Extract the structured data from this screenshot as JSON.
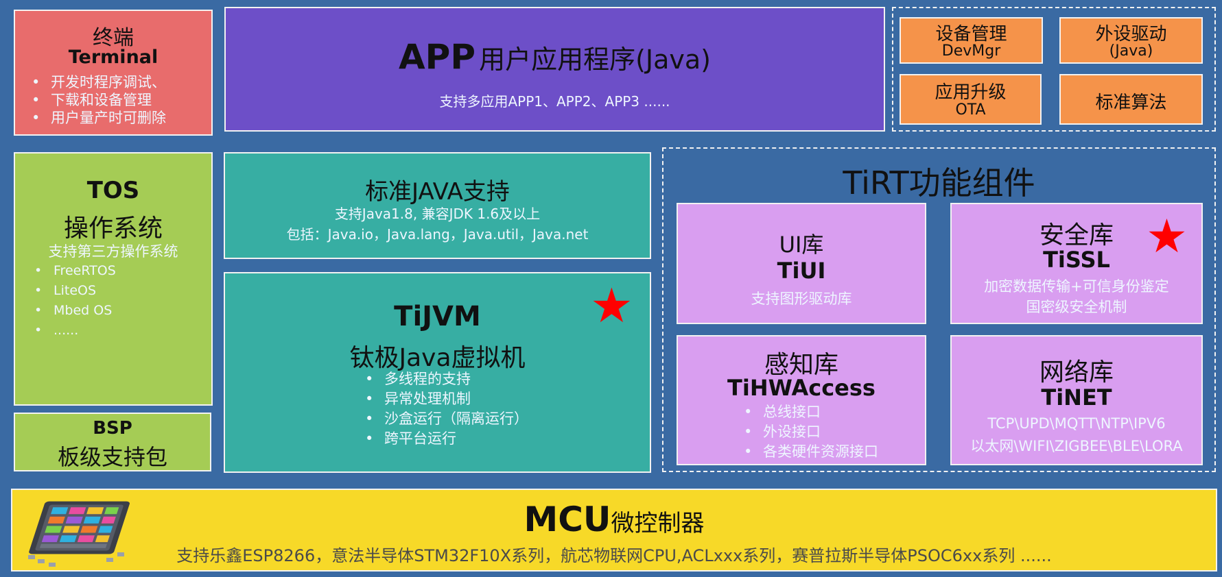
{
  "terminal": {
    "title_cn": "终端",
    "title_en": "Terminal",
    "bullets": [
      "开发时程序调试、",
      "下载和设备管理",
      "用户量产时可删除"
    ]
  },
  "app": {
    "title_en": "APP",
    "title_cn": "用户应用程序(Java)",
    "subtitle": "支持多应用APP1、APP2、APP3 ......"
  },
  "app_side": {
    "devmgr_cn": "设备管理",
    "devmgr_en": "DevMgr",
    "driver_cn": "外设驱动",
    "driver_en": "(Java)",
    "ota_cn": "应用升级",
    "ota_en": "OTA",
    "algo": "标准算法"
  },
  "tos": {
    "title_en": "TOS",
    "title_cn": "操作系统",
    "subtitle": "支持第三方操作系统",
    "items": [
      "FreeRTOS",
      "LiteOS",
      "Mbed OS",
      "......"
    ]
  },
  "bsp": {
    "title_en": "BSP",
    "title_cn": "板级支持包"
  },
  "java": {
    "title": "标准JAVA支持",
    "line1": "支持Java1.8, 兼容JDK 1.6及以上",
    "line2": "包括：Java.io，Java.lang，Java.util，Java.net"
  },
  "tijvm": {
    "title_en": "TiJVM",
    "title_cn": "钛极Java虚拟机",
    "items": [
      "多线程的支持",
      "异常处理机制",
      "沙盒运行（隔离运行）",
      "跨平台运行"
    ]
  },
  "tirt": {
    "title": "TiRT功能组件",
    "ui": {
      "cn": "UI库",
      "en": "TiUI",
      "desc": "支持图形驱动库"
    },
    "ssl": {
      "cn": "安全库",
      "en": "TiSSL",
      "desc1": "加密数据传输+可信身份鉴定",
      "desc2": "国密级安全机制"
    },
    "hw": {
      "cn": "感知库",
      "en": "TiHWAccess",
      "items": [
        "总线接口",
        "外设接口",
        "各类硬件资源接口"
      ]
    },
    "net": {
      "cn": "网络库",
      "en": "TiNET",
      "desc1": "TCP\\UPD\\MQTT\\NTP\\IPV6",
      "desc2": "以太网\\WIFI\\ZIGBEE\\BLE\\LORA"
    }
  },
  "mcu": {
    "title_en": "MCU",
    "title_cn": "微控制器",
    "desc": "支持乐鑫ESP8266，意法半导体STM32F10X系列，航芯物联网CPU,ACLxxx系列，赛普拉斯半导体PSOC6xx系列 ......"
  },
  "colors": {
    "background": "#3a6aa3",
    "terminal": "#e86c6c",
    "app": "#6d4fc8",
    "orange": "#f5934a",
    "green": "#a5cc55",
    "teal": "#37aea3",
    "lilac": "#d99ef0",
    "mcu": "#f7d928",
    "star": "#ff0000"
  },
  "icons": {
    "star": "star-icon",
    "chip": "chip-icon"
  }
}
